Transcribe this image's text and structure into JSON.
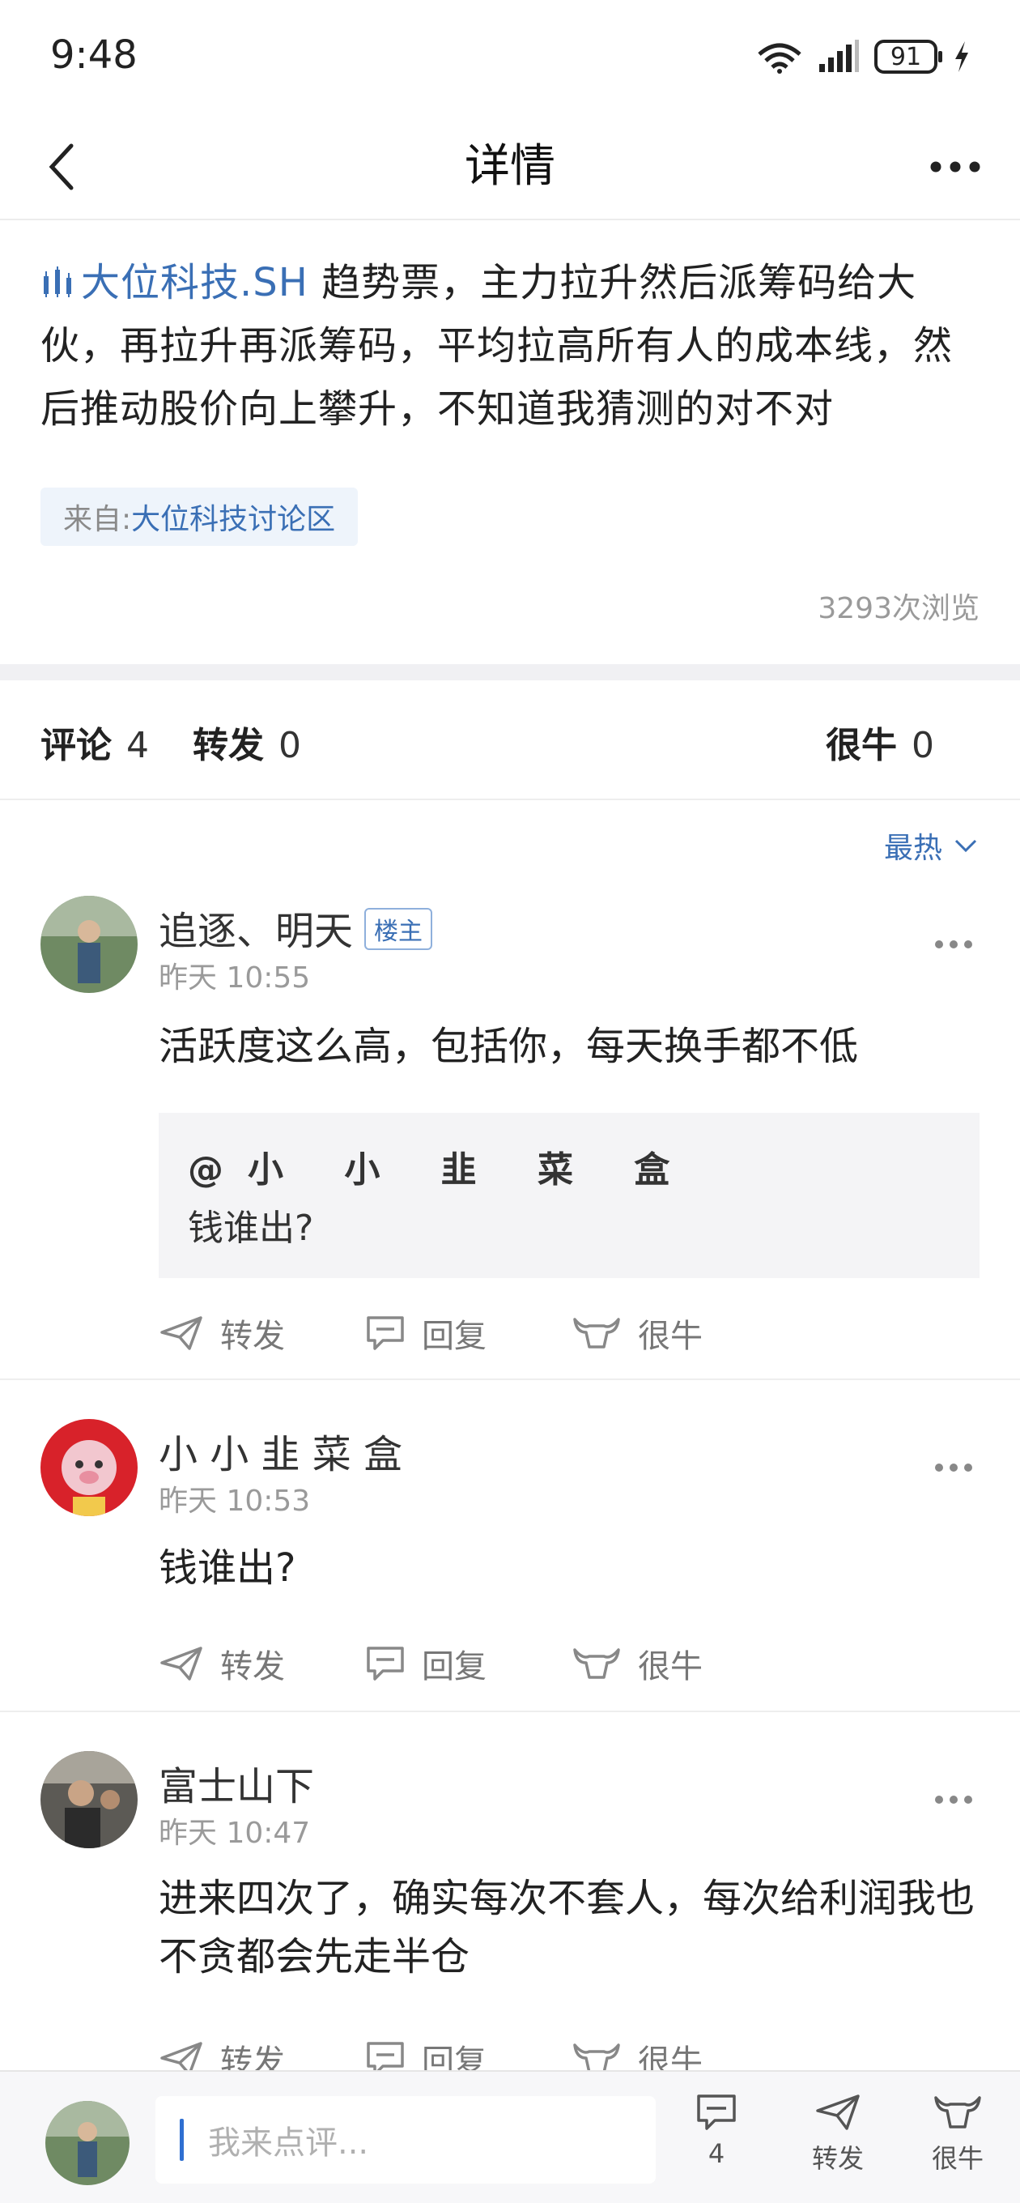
{
  "status_bar": {
    "time": "9:48",
    "battery": "91"
  },
  "header": {
    "title": "详情"
  },
  "post": {
    "stock_tag": "大位科技.SH",
    "text": "趋势票，主力拉升然后派筹码给大伙，再拉升再派筹码，平均拉高所有人的成本线，然后推动股价向上攀升，不知道我猜测的对不对",
    "source_prefix": "来自:",
    "source_name": "大位科技讨论区",
    "views": "3293次浏览"
  },
  "tabs": {
    "comments_label": "评论",
    "comments_count": "4",
    "reposts_label": "转发",
    "reposts_count": "0",
    "likes_label": "很牛",
    "likes_count": "0"
  },
  "sort": {
    "label": "最热"
  },
  "comments": [
    {
      "name": "追逐、明天",
      "badge": "楼主",
      "time": "昨天 10:55",
      "text": "活跃度这么高，包括你，每天换手都不低",
      "quote_user": "@小 小 韭 菜 盒",
      "quote_text": "钱谁出?"
    },
    {
      "name": "小 小 韭 菜 盒",
      "time": "昨天 10:53",
      "text": "钱谁出?"
    },
    {
      "name": "富士山下",
      "time": "昨天 10:47",
      "text": "进来四次了，确实每次不套人，每次给利润我也不贪都会先走半仓"
    }
  ],
  "actions": {
    "repost": "转发",
    "reply": "回复",
    "like": "很牛"
  },
  "bottom_bar": {
    "placeholder": "我来点评...",
    "comment_count": "4",
    "repost_label": "转发",
    "like_label": "很牛"
  },
  "colors": {
    "accent": "#3a6fb5",
    "muted": "#9a9a9a"
  }
}
